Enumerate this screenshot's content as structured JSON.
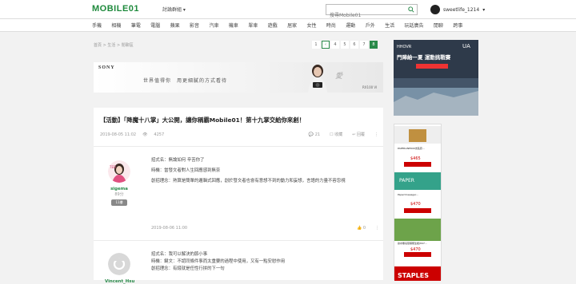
{
  "colors": {
    "accent": "#2a8a4a",
    "link": "#1e8a3c"
  },
  "header": {
    "logo": "MOBILE01",
    "dropdown_label": "討論群組 ▾",
    "search_placeholder": "搜尋Mobile01",
    "username": "sweetlife_1214",
    "user_caret": "▾",
    "icons": [
      "search-icon",
      "avatar",
      "caret-down-icon"
    ]
  },
  "nav": [
    "手機",
    "相機",
    "筆電",
    "電腦",
    "蘋果",
    "影音",
    "汽車",
    "機車",
    "單車",
    "遊戲",
    "居家",
    "女性",
    "時尚",
    "運動",
    "戶外",
    "生活",
    "玩話廣告",
    "閒聊",
    "跨事"
  ],
  "breadcrumb": "首頁  >  生活  >  閒聊區",
  "pager": {
    "prev": "‹",
    "pages": [
      "1",
      "4",
      "5",
      "6",
      "7"
    ],
    "current": "8"
  },
  "ad_banner": {
    "brand": "SONY",
    "slogan": "世界值得你　用更細膩的方式看待",
    "model": "RX100 VI"
  },
  "thread": {
    "title": "【活動】「降魔十八掌」大公開，讓你稱霸Mobile01！第十九掌交給你來創！",
    "date": "2019-08-05 11:02",
    "views": "4257",
    "replies": "21",
    "save_label": "收藏",
    "reply_label": "回覆",
    "more": "⋮",
    "views_icon": "eye-icon",
    "reply_icon": "reply-icon"
  },
  "posts": [
    {
      "author": "sigema",
      "points": "89分",
      "level": "11樓",
      "lines": [
        "招式名：無論如何 辛苦你了",
        "時機：當發文者對人生回應感到無奈",
        "創招理念：熟算是簡單的邏輯式回應，創於發文者也會有意想不到的動力和妄想，言語的力量不容忽視"
      ],
      "date": "2019-08-06 11:00",
      "likes": "0",
      "more": "⋮"
    },
    {
      "author": "Vincent_Hsu",
      "lines": [
        "招式名：我可以解決的節小事",
        "時機：鍵文：不認同條件事而太重要的過程中使用，又有一點安慰作用",
        "創招理念：有錢就是任性行拼的下一句"
      ]
    }
  ],
  "sidebar_ads": {
    "top_text": "門陣給一夏 運動挑戰賽",
    "items": [
      {
        "title": "PAPERLINE600支裝原...",
        "price": "$465"
      },
      {
        "title": "PaperOneeager...",
        "price": "$470"
      },
      {
        "title": "熱水無毒環保衛生紙(847...",
        "price": "$470"
      }
    ],
    "bottom_brand": "STAPLES"
  }
}
